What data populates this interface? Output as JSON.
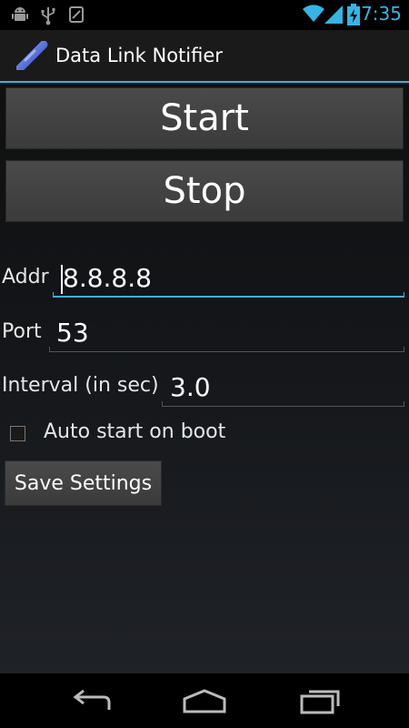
{
  "status_bar": {
    "time": "7:35",
    "left_icons": [
      "android-debug-icon",
      "usb-icon",
      "sync-icon"
    ],
    "right_icons": [
      "wifi-icon",
      "signal-icon",
      "battery-charging-icon"
    ],
    "accent_color": "#33b5e5"
  },
  "action_bar": {
    "title": "Data Link Notifier",
    "icon": "app-link-icon"
  },
  "main": {
    "start_label": "Start",
    "stop_label": "Stop",
    "addr": {
      "label": "Addr",
      "value": "8.8.8.8"
    },
    "port": {
      "label": "Port",
      "value": "53"
    },
    "interval": {
      "label": "Interval (in sec)",
      "value": "3.0"
    },
    "auto_start": {
      "label": "Auto start on boot",
      "checked": false
    },
    "save_label": "Save Settings"
  },
  "nav_bar": {
    "buttons": [
      "back-icon",
      "home-icon",
      "recent-apps-icon"
    ]
  }
}
